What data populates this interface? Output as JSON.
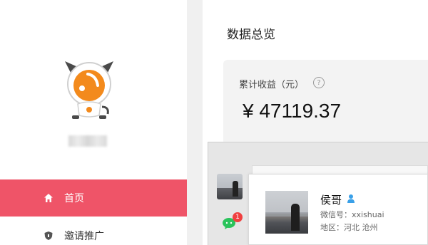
{
  "sidebar": {
    "nav": [
      {
        "label": "首页",
        "icon": "home-icon",
        "active": true
      },
      {
        "label": "邀请推广",
        "icon": "shield-icon",
        "active": false
      }
    ]
  },
  "main": {
    "title": "数据总览",
    "stats": {
      "label": "累计收益（元）",
      "help_icon": "?",
      "value": "¥ 47119.37"
    }
  },
  "chat": {
    "unread_count": "1",
    "contact_card": {
      "name": "侯哥",
      "wechat_id": "微信号：xxishuai",
      "region": "地区：河北 沧州"
    }
  },
  "colors": {
    "accent": "#ef5468",
    "wechat_green": "#2ac35b",
    "badge_red": "#f04040"
  }
}
